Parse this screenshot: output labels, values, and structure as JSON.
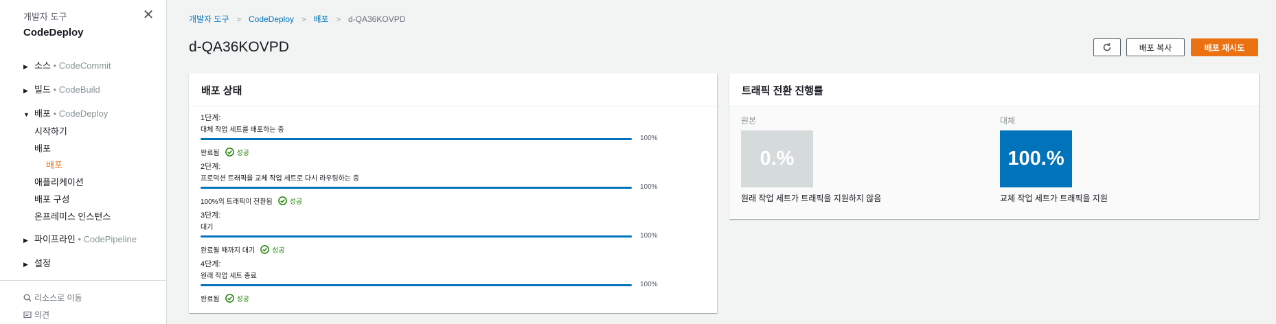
{
  "sidebar": {
    "section": "개발자 도구",
    "app": "CodeDeploy",
    "groups": [
      {
        "label": "소스",
        "service": "CodeCommit",
        "expanded": false
      },
      {
        "label": "빌드",
        "service": "CodeBuild",
        "expanded": false
      },
      {
        "label": "배포",
        "service": "CodeDeploy",
        "expanded": true
      },
      {
        "label": "파이프라인",
        "service": "CodePipeline",
        "expanded": false
      },
      {
        "label": "설정",
        "service": "",
        "expanded": false
      }
    ],
    "deploy_items": [
      "시작하기",
      "배포",
      "배포",
      "애플리케이션",
      "배포 구성",
      "온프레미스 인스턴스"
    ],
    "service_prefix": "•",
    "utils": {
      "go_to_resource": "리소스로 이동",
      "feedback": "의견"
    }
  },
  "breadcrumb": [
    "개발자 도구",
    "CodeDeploy",
    "배포",
    "d-QA36KOVPD"
  ],
  "page": {
    "title": "d-QA36KOVPD",
    "buttons": {
      "copy": "배포 복사",
      "retry": "배포 재시도"
    }
  },
  "status_panel": {
    "title": "배포 상태",
    "stages": [
      {
        "title": "1단계:",
        "desc": "대체 작업 세트를 배포하는 중",
        "progress": 100,
        "progress_label": "100%",
        "footer": "완료됨",
        "status": "성공"
      },
      {
        "title": "2단계:",
        "desc": "프로덕션 트래픽을 교체 작업 세트로 다시 라우팅하는 중",
        "progress": 100,
        "progress_label": "100%",
        "footer": "100%의 트래픽이 전환됨",
        "status": "성공"
      },
      {
        "title": "3단계:",
        "desc": "대기",
        "progress": 100,
        "progress_label": "100%",
        "footer": "완료될 때까지 대기",
        "status": "성공"
      },
      {
        "title": "4단계:",
        "desc": "원래 작업 세트 종료",
        "progress": 100,
        "progress_label": "100%",
        "footer": "완료됨",
        "status": "성공"
      }
    ]
  },
  "traffic_panel": {
    "title": "트래픽 전환 진행률",
    "original": {
      "label": "원본",
      "value": "0.%",
      "desc": "원래 작업 세트가 트래픽을 지원하지 않음",
      "color": "#d5dbdb"
    },
    "replacement": {
      "label": "대체",
      "value": "100.%",
      "desc": "교체 작업 세트가 트래픽을 지원",
      "color": "#0073bb"
    }
  },
  "colors": {
    "accent": "#ec7211",
    "link": "#0073bb",
    "success": "#1d8102"
  }
}
